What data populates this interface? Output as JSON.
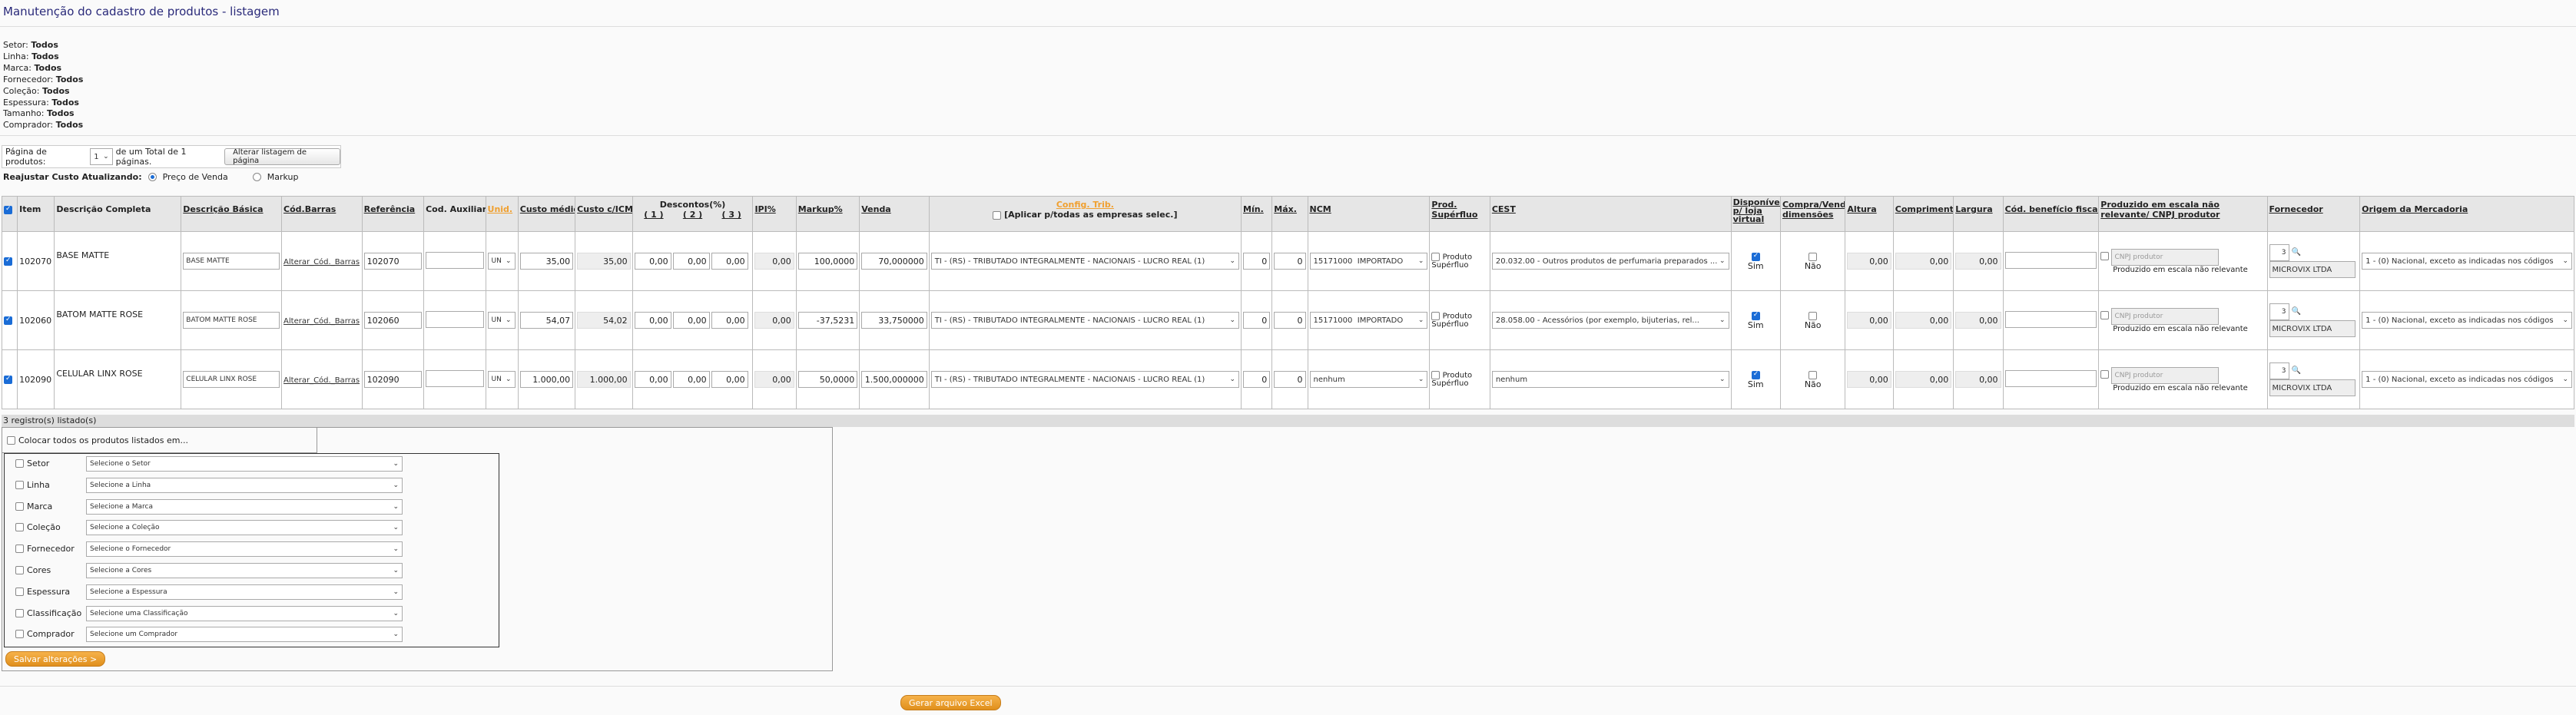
{
  "page_title": "Manutenção do cadastro de produtos - listagem",
  "filters": [
    {
      "label": "Setor:",
      "value": "Todos"
    },
    {
      "label": "Linha:",
      "value": "Todos"
    },
    {
      "label": "Marca:",
      "value": "Todos"
    },
    {
      "label": "Fornecedor:",
      "value": "Todos"
    },
    {
      "label": "Coleção:",
      "value": "Todos"
    },
    {
      "label": "Espessura:",
      "value": "Todos"
    },
    {
      "label": "Tamanho:",
      "value": "Todos"
    },
    {
      "label": "Comprador:",
      "value": "Todos"
    }
  ],
  "pagination": {
    "label": "Página de produtos:",
    "current": "1",
    "total_text": "de um Total de 1 páginas.",
    "change_button": "Alterar listagem de página"
  },
  "reajust": {
    "label": "Reajustar Custo Atualizando:",
    "option1": "Preço de Venda",
    "option2": "Markup"
  },
  "columns": {
    "item": "Item",
    "desc_completa": "Descrição Completa",
    "desc_basica": "Descrição Básica",
    "cod_barras": "Cód.Barras",
    "referencia": "Referência",
    "cod_auxiliar": "Cod. Auxiliar",
    "unid": "Unid.",
    "custo_medio": "Custo médio",
    "custo_icms": "Custo c/ICMS",
    "descontos": "Descontos(%)",
    "desc1": "( 1 )",
    "desc2": "( 2 )",
    "desc3": "( 3 )",
    "ipi": "IPI%",
    "markup": "Markup%",
    "venda": "Venda",
    "config_trib": "Config. Trib.",
    "aplicar": "[Aplicar p/todas as empresas selec.]",
    "min": "Mín.",
    "max": "Máx.",
    "ncm": "NCM",
    "prod_superfluo": "Prod. Supérfluo",
    "cest": "CEST",
    "disponivel": "Disponível p/ loja virtual",
    "compra_venda": "Compra/Venda dimensões",
    "altura": "Altura",
    "comprimento": "Comprimento",
    "largura": "Largura",
    "cod_beneficio": "Cód. benefício fiscal",
    "escala": "Produzido em escala não relevante/ CNPJ produtor",
    "fornecedor": "Fornecedor",
    "origem": "Origem da Mercadoria"
  },
  "rows": [
    {
      "item": "102070",
      "desc_completa": "BASE MATTE",
      "desc_basica": "BASE MATTE",
      "cod_barras": "Alterar_Cód._Barras",
      "referencia": "102070",
      "cod_auxiliar": "",
      "unid": "UN",
      "custo_medio": "35,00",
      "custo_icms": "35,00",
      "desc1": "0,00",
      "desc2": "0,00",
      "desc3": "0,00",
      "ipi": "0,00",
      "markup": "100,0000",
      "venda": "70,000000",
      "config_trib": "TI - (RS) - TRIBUTADO INTEGRALMENTE - NACIONAIS - LUCRO REAL (1)",
      "min": "0",
      "max": "0",
      "ncm_code": "15171000",
      "ncm_type": "IMPORTADO",
      "prod_superfluo_label": "Produto Supérfluo",
      "cest": "20.032.00 - Outros produtos de perfumaria preparados ...",
      "disponivel": "Sim",
      "compra_venda": "Não",
      "altura": "0,00",
      "comprimento": "0,00",
      "largura": "0,00",
      "cod_beneficio": "",
      "cnpj_placeholder": "CNPJ produtor",
      "escala_label": "Produzido em escala não relevante",
      "fornecedor_code": "3",
      "fornecedor_name": "MICROVIX LTDA",
      "origem": "1 - (0) Nacional, exceto as indicadas nos códigos"
    },
    {
      "item": "102060",
      "desc_completa": "BATOM MATTE ROSE",
      "desc_basica": "BATOM MATTE ROSE",
      "cod_barras": "Alterar_Cód._Barras",
      "referencia": "102060",
      "cod_auxiliar": "",
      "unid": "UN",
      "custo_medio": "54,07",
      "custo_icms": "54,02",
      "desc1": "0,00",
      "desc2": "0,00",
      "desc3": "0,00",
      "ipi": "0,00",
      "markup": "-37,5231",
      "venda": "33,750000",
      "config_trib": "TI - (RS) - TRIBUTADO INTEGRALMENTE - NACIONAIS - LUCRO REAL (1)",
      "min": "0",
      "max": "0",
      "ncm_code": "15171000",
      "ncm_type": "IMPORTADO",
      "prod_superfluo_label": "Produto Supérfluo",
      "cest": "28.058.00 - Acessórios (por exemplo, bijuterias, rel...",
      "disponivel": "Sim",
      "compra_venda": "Não",
      "altura": "0,00",
      "comprimento": "0,00",
      "largura": "0,00",
      "cod_beneficio": "",
      "cnpj_placeholder": "CNPJ produtor",
      "escala_label": "Produzido em escala não relevante",
      "fornecedor_code": "3",
      "fornecedor_name": "MICROVIX LTDA",
      "origem": "1 - (0) Nacional, exceto as indicadas nos códigos"
    },
    {
      "item": "102090",
      "desc_completa": "CELULAR LINX ROSE",
      "desc_basica": "CELULAR LINX ROSE",
      "cod_barras": "Alterar_Cód._Barras",
      "referencia": "102090",
      "cod_auxiliar": "",
      "unid": "UN",
      "custo_medio": "1.000,00",
      "custo_icms": "1.000,00",
      "desc1": "0,00",
      "desc2": "0,00",
      "desc3": "0,00",
      "ipi": "0,00",
      "markup": "50,0000",
      "venda": "1.500,000000",
      "config_trib": "TI - (RS) - TRIBUTADO INTEGRALMENTE - NACIONAIS - LUCRO REAL (1)",
      "min": "0",
      "max": "0",
      "ncm_code": "nenhum",
      "ncm_type": "",
      "prod_superfluo_label": "Produto Supérfluo",
      "cest": "nenhum",
      "disponivel": "Sim",
      "compra_venda": "Não",
      "altura": "0,00",
      "comprimento": "0,00",
      "largura": "0,00",
      "cod_beneficio": "",
      "cnpj_placeholder": "CNPJ produtor",
      "escala_label": "Produzido em escala não relevante",
      "fornecedor_code": "3",
      "fornecedor_name": "MICROVIX LTDA",
      "origem": "1 - (0) Nacional, exceto as indicadas nos códigos"
    }
  ],
  "records_count": "3 registro(s) listado(s)",
  "bulk": {
    "colocar_label": "Colocar todos os produtos listados em...",
    "fields": [
      {
        "label": "Setor",
        "placeholder": "Selecione o Setor"
      },
      {
        "label": "Linha",
        "placeholder": "Selecione a Linha"
      },
      {
        "label": "Marca",
        "placeholder": "Selecione a Marca"
      },
      {
        "label": "Coleção",
        "placeholder": "Selecione a Coleção"
      },
      {
        "label": "Fornecedor",
        "placeholder": "Selecione o Fornecedor"
      },
      {
        "label": "Cores",
        "placeholder": "Selecione a Cores"
      },
      {
        "label": "Espessura",
        "placeholder": "Selecione a Espessura"
      },
      {
        "label": "Classificação",
        "placeholder": "Selecione uma Classificação"
      },
      {
        "label": "Comprador",
        "placeholder": "Selecione um Comprador"
      }
    ],
    "save_button": "Salvar alterações >"
  },
  "excel_button": "Gerar arquivo Excel",
  "colors": {
    "orange": "#f0a030",
    "title": "#2a2a7a",
    "check_blue": "#1a6cd6"
  },
  "icons": {
    "search": "magnifier-icon",
    "dropdown": "chevron-down-icon"
  }
}
